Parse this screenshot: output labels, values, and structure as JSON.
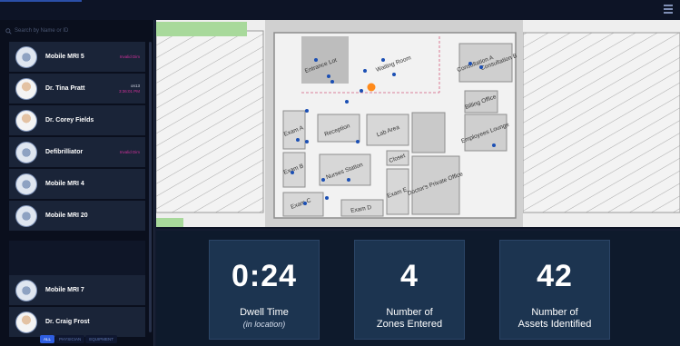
{
  "search": {
    "placeholder": "Search by Name or ID"
  },
  "sidebar": {
    "items": [
      {
        "name": "Mobile MRI 5",
        "status": "Invalid Dim",
        "type": "device"
      },
      {
        "name": "Dr. Tina Pratt",
        "status_on": "on13",
        "status": "3:36:01 PM",
        "type": "person"
      },
      {
        "name": "Dr. Corey Fields",
        "status": "",
        "type": "person"
      },
      {
        "name": "Defibrilliator",
        "status": "Invalid Dim",
        "type": "device"
      },
      {
        "name": "Mobile MRI 4",
        "status": "",
        "type": "device"
      },
      {
        "name": "Mobile MRI 20",
        "status": "",
        "type": "device"
      },
      {
        "name": "Mobile MRI 7",
        "status": "",
        "type": "device"
      },
      {
        "name": "Dr. Craig Frost",
        "status": "",
        "type": "person"
      }
    ],
    "tabs": [
      "ALL",
      "PHYSICIAN",
      "EQUIPMENT"
    ]
  },
  "map": {
    "rooms": {
      "entrance": "Entrance Lot",
      "waiting": "Waiting Room",
      "consultation_a": "Consultation A",
      "consultation_b": "Consultation B",
      "billing": "Billing Office",
      "employees": "Employees Lounge",
      "exam_a": "Exam A",
      "reception": "Reception",
      "lab": "Lab Area",
      "exam_b": "Exam B",
      "nurses": "Nurses Station",
      "closet": "Closet",
      "doctors": "Doctor's Private Office",
      "exam_e": "Exam E",
      "exam_c": "Exam C",
      "exam_d": "Exam D"
    }
  },
  "stats": {
    "dwell_value": "0:24",
    "dwell_label": "Dwell Time",
    "dwell_sub": "(in location)",
    "zones_value": "4",
    "zones_label1": "Number of",
    "zones_label2": "Zones Entered",
    "assets_value": "42",
    "assets_label1": "Number of",
    "assets_label2": "Assets Identified"
  },
  "colors": {
    "tracked_person": "#ff8a1a",
    "asset_dot": "#1b4fb4",
    "accent": "#2f5ee0"
  }
}
